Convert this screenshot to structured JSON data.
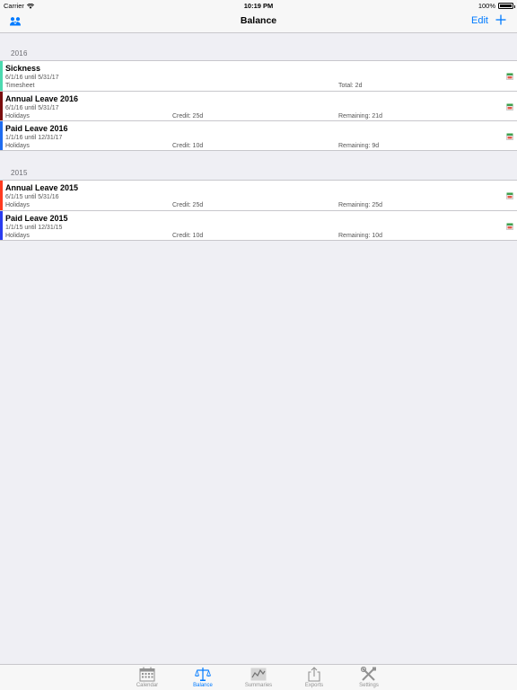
{
  "status_bar": {
    "carrier": "Carrier",
    "time": "10:19 PM",
    "battery": "100%"
  },
  "nav": {
    "title": "Balance",
    "edit_label": "Edit",
    "left_icon": "account-icon",
    "add_icon": "plus-icon"
  },
  "sections": [
    {
      "header": "2016",
      "rows": [
        {
          "name": "Sickness",
          "dates": "6/1/16 until 5/31/17",
          "category": "Timesheet",
          "credit": "",
          "remaining": "Total: 2d",
          "color": "#4cd9b0"
        },
        {
          "name": "Annual Leave 2016",
          "dates": "6/1/16 until 5/31/17",
          "category": "Holidays",
          "credit": "Credit: 25d",
          "remaining": "Remaining: 21d",
          "color": "#7a0e0e"
        },
        {
          "name": "Paid Leave 2016",
          "dates": "1/1/16 until 12/31/17",
          "category": "Holidays",
          "credit": "Credit: 10d",
          "remaining": "Remaining: 9d",
          "color": "#1e6cf0"
        }
      ]
    },
    {
      "header": "2015",
      "rows": [
        {
          "name": "Annual Leave 2015",
          "dates": "6/1/15 until 5/31/16",
          "category": "Holidays",
          "credit": "Credit: 25d",
          "remaining": "Remaining: 25d",
          "color": "#ff3b20"
        },
        {
          "name": "Paid Leave 2015",
          "dates": "1/1/15 until 12/31/15",
          "category": "Holidays",
          "credit": "Credit: 10d",
          "remaining": "Remaining: 10d",
          "color": "#2a3cf0"
        }
      ]
    }
  ],
  "tabs": [
    {
      "label": "Calendar",
      "icon": "calendar-icon",
      "active": false
    },
    {
      "label": "Balance",
      "icon": "scale-icon",
      "active": true
    },
    {
      "label": "Summaries",
      "icon": "chart-icon",
      "active": false
    },
    {
      "label": "Exports",
      "icon": "share-icon",
      "active": false
    },
    {
      "label": "Settings",
      "icon": "tools-icon",
      "active": false
    }
  ],
  "colors": {
    "accent": "#007aff",
    "inactive_tab": "#929292",
    "background": "#efeff4"
  }
}
